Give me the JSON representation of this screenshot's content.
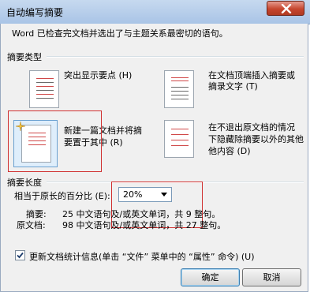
{
  "window": {
    "title": "自动编写摘要"
  },
  "intro_text": "Word 已检查完文档并选出了与主题关系最密切的语句。",
  "summary_type": {
    "group_label": "摘要类型",
    "options": [
      {
        "label": "突出显示要点 (H)",
        "line1": "突出显示要点 (H)"
      },
      {
        "line1": "在文档顶端插入摘要或",
        "line2": "摘录文字 (T)"
      },
      {
        "line1": "新建一篇文档并将摘",
        "line2": "要置于其中 (R)"
      },
      {
        "line1": "在不退出原文档的情况",
        "line2": "下隐藏除摘要以外的其他",
        "line3": "他内容 (D)"
      }
    ]
  },
  "summary_length": {
    "group_label": "摘要长度",
    "percent_label": "相当于原长的百分比 (E):",
    "percent_value": "20%",
    "summary_label": "摘要:",
    "summary_stats": "25 中文语句及/或英文单词，共 9 整句。",
    "original_label": "原文档:",
    "original_stats": "98 中文语句及/或英文单词，共 27 整句。"
  },
  "update_stats": {
    "checked": true,
    "label": "更新文档统计信息(单击 “文件” 菜单中的 “属性” 命令) (U)"
  },
  "buttons": {
    "ok": "确定",
    "cancel": "取消"
  },
  "colors": {
    "highlight_box": "#d03030",
    "titlebar": "#b4cbe9",
    "dialog_bg": "#f0f0f0"
  }
}
